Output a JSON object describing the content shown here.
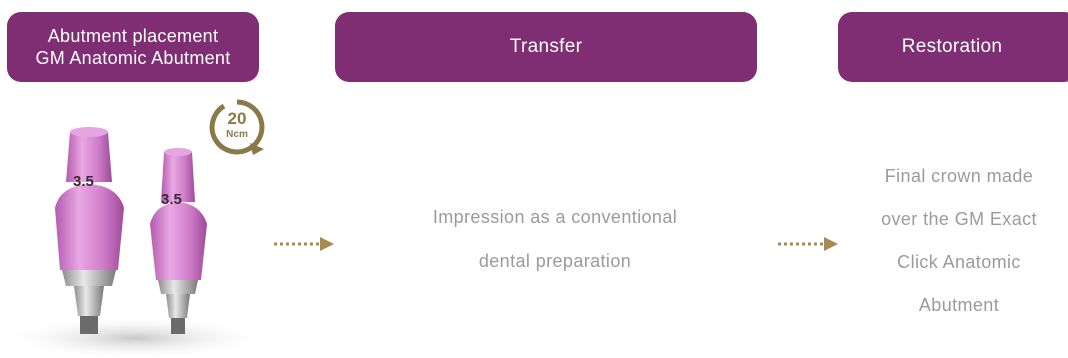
{
  "stages": [
    {
      "label_line1": "Abutment placement",
      "label_line2": "GM Anatomic Abutment"
    },
    {
      "label": "Transfer"
    },
    {
      "label": "Restoration"
    }
  ],
  "descriptions": {
    "transfer": [
      "Impression as a conventional",
      "dental preparation"
    ],
    "restoration": [
      "Final crown made",
      "over the GM Exact",
      "Click Anatomic",
      "Abutment"
    ]
  },
  "torque_badge": {
    "value": "20",
    "unit": "Ncm",
    "icon": "torque-rotation-icon"
  },
  "abutments": [
    {
      "size_label": "3.5"
    },
    {
      "size_label": "3.5"
    }
  ],
  "colors": {
    "stage_box": "#7f2e74",
    "description_text": "#9b9b9b",
    "arrow": "#a88a4e",
    "torque": "#8a7a48",
    "abutment_pink": "#cf7cc9"
  }
}
